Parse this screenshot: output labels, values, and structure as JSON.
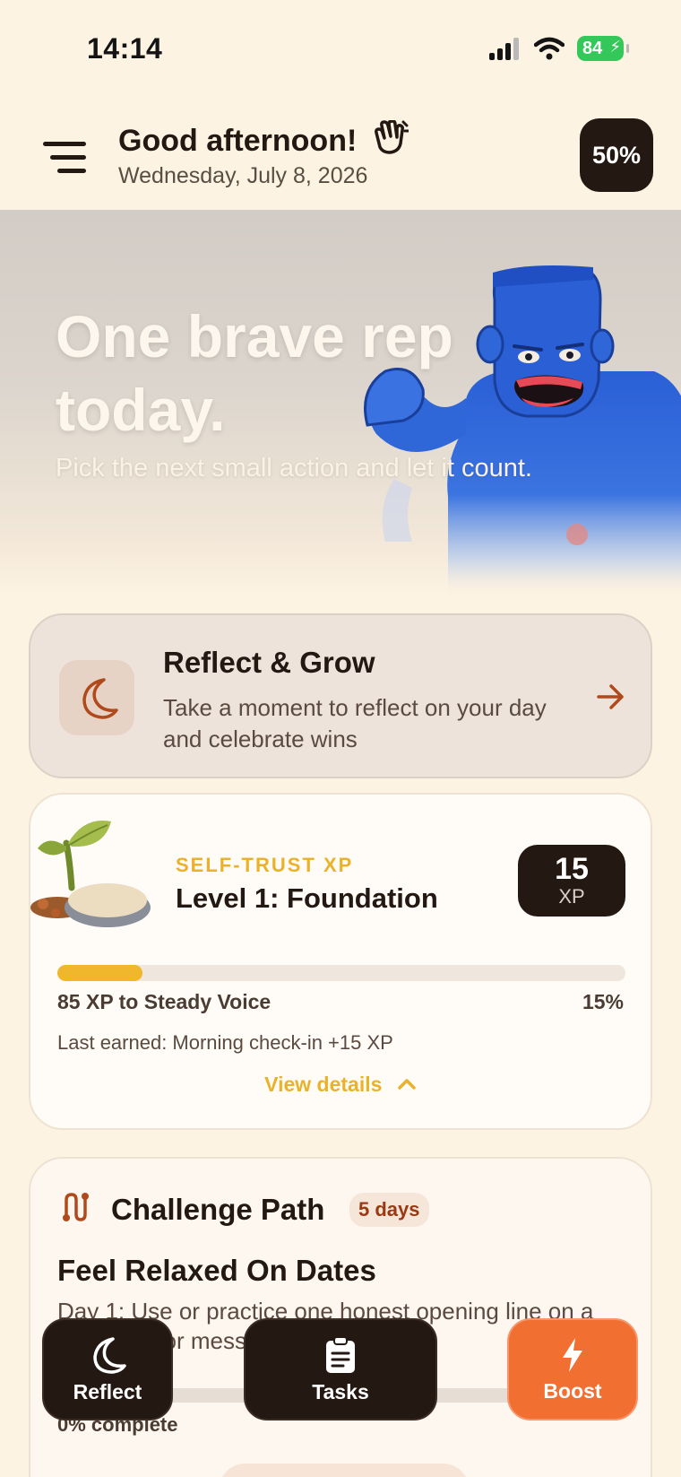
{
  "status_bar": {
    "time": "14:14",
    "battery": "84",
    "icons": [
      "signal-icon",
      "wifi-icon",
      "battery-icon"
    ]
  },
  "header": {
    "greeting": "Good afternoon!",
    "greeting_icon": "waving-hand-icon",
    "date": "Wednesday, July 8, 2026",
    "progress": "50%"
  },
  "hero": {
    "title": "One brave rep today.",
    "subtitle": "Pick the next small action and let it count.",
    "mascot": "blue-monster-flexing"
  },
  "reflect_card": {
    "title": "Reflect & Grow",
    "description": "Take a moment to reflect on your day and celebrate wins",
    "icon": "moon-icon"
  },
  "xp_card": {
    "eyebrow": "SELF-TRUST XP",
    "level": "Level 1: Foundation",
    "xp_value": "15",
    "xp_unit": "XP",
    "progress_fraction": 0.15,
    "next_label": "85 XP to Steady Voice",
    "percent": "15%",
    "last_earned": "Last earned: Morning check-in +15 XP",
    "view_details": "View details"
  },
  "challenge_card": {
    "title": "Challenge Path",
    "days": "5 days",
    "goal": "Feel Relaxed On Dates",
    "description": "Day 1: Use or practice one honest opening line on a date, call, or message",
    "progress_fraction": 0,
    "complete_label": "0% complete"
  },
  "actions": {
    "reflect": "Reflect",
    "tasks": "Tasks",
    "boost": "Boost"
  },
  "colors": {
    "background": "#fdf3e3",
    "dark": "#241812",
    "accent_yellow": "#f0b62c",
    "accent_orange": "#f26f32",
    "accent_rust": "#b04a1c"
  }
}
